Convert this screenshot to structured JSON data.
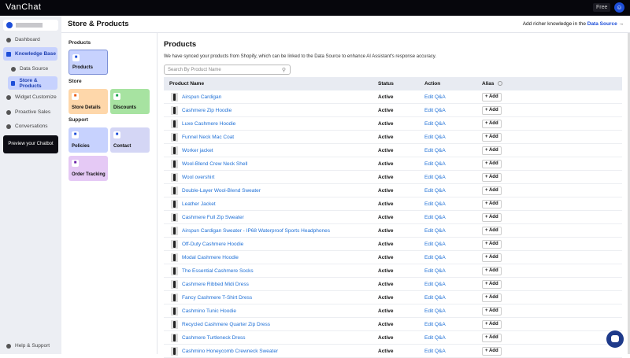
{
  "app": {
    "name": "VanChat",
    "plan": "Free",
    "avatar_icon": "user-icon"
  },
  "sidebar": {
    "items": [
      {
        "label": "Dashboard",
        "icon": "dashboard-icon"
      },
      {
        "label": "Knowledge Base",
        "icon": "book-icon",
        "active": true
      },
      {
        "label": "Data Source",
        "icon": "database-icon"
      },
      {
        "label": "Store & Products",
        "icon": "store-icon",
        "active": true
      },
      {
        "label": "Widget Customize",
        "icon": "widget-icon"
      },
      {
        "label": "Proactive Sales",
        "icon": "sales-icon"
      },
      {
        "label": "Conversations",
        "icon": "chat-icon"
      }
    ],
    "preview": "Preview your Chatbot",
    "help": "Help & Support"
  },
  "header": {
    "title": "Store & Products",
    "hint": "Add richer knowledge in the",
    "hint_link": "Data Source"
  },
  "panel": {
    "sections": [
      "Products",
      "Store",
      "Support"
    ],
    "cards": [
      {
        "label": "Products",
        "color": "#c7d2fe"
      },
      {
        "label": "Store Details",
        "color": "#fed7aa"
      },
      {
        "label": "Discounts",
        "color": "#a7e3a1"
      },
      {
        "label": "Policies",
        "color": "#c7d2fe"
      },
      {
        "label": "Contact",
        "color": "#d4d6f5"
      },
      {
        "label": "Order Tracking",
        "color": "#e5c9f5"
      }
    ]
  },
  "main": {
    "title": "Products",
    "description": "We have synced your products from Shopify, which can be linked to the Data Source to enhance AI Assistant's response accuracy.",
    "search_placeholder": "Search By Product Name",
    "columns": [
      "Product Name",
      "Status",
      "Action",
      "Alias"
    ],
    "action_label": "Edit Q&A",
    "add_label": "+ Add",
    "status": "Active",
    "products": [
      "Airspun Cardigan",
      "Cashmere Zip Hoodie",
      "Luxe Cashmere Hoodie",
      "Funnel Neck Mac Coat",
      "Worker jacket",
      "Wool-Blend Crew Neck Shell",
      "Wool overshirt",
      "Double-Layer Wool-Blend Sweater",
      "Leather Jacket",
      "Cashmere Full Zip Sweater",
      "Airspun Cardigan Sweater - IP68 Waterproof Sports Headphones",
      "Off-Duty Cashmere Hoodie",
      "Modal Cashmere Hoodie",
      "The Essential Cashmere Socks",
      "Cashmere Ribbed Midi Dress",
      "Fancy Cashmere T-Shirt Dress",
      "Cashmino Tunic Hoodie",
      "Recycled Cashmere Quarter Zip Dress",
      "Cashmere Turtleneck Dress",
      "Cashmino Honeycomb Crewneck Sweater"
    ]
  }
}
